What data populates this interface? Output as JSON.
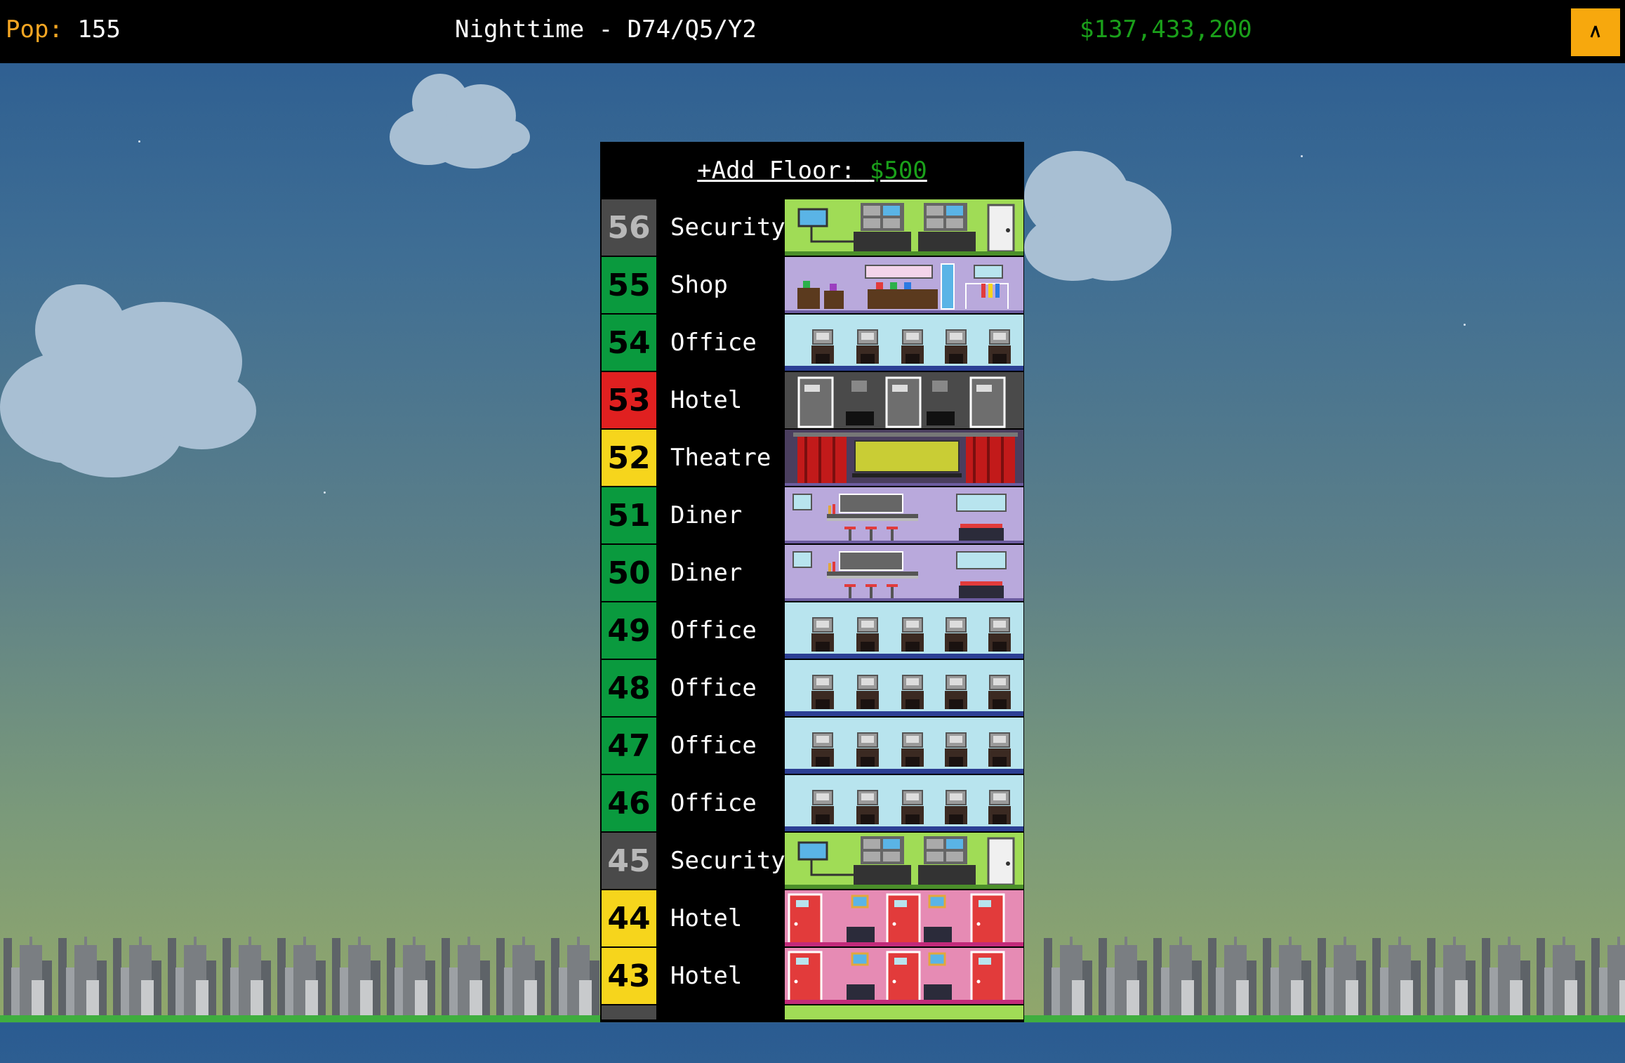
{
  "header": {
    "pop_label": "Pop:",
    "pop_value": "155",
    "time_text": "Nighttime - D74/Q5/Y2",
    "money": "$137,433,200",
    "menu_icon": "cursor-icon"
  },
  "tower": {
    "add_floor_label": "+Add Floor:",
    "add_floor_cost": "$500"
  },
  "colors": {
    "status_green": "#0a9a3e",
    "status_red": "#e02020",
    "status_yellow": "#f6d51c",
    "status_gray": "#4a4a4a"
  },
  "floors": [
    {
      "num": "56",
      "name": "Security",
      "type": "security",
      "status": "gray"
    },
    {
      "num": "55",
      "name": "Shop",
      "type": "shop",
      "status": "green"
    },
    {
      "num": "54",
      "name": "Office",
      "type": "office",
      "status": "green"
    },
    {
      "num": "53",
      "name": "Hotel",
      "type": "hotel-dark",
      "status": "red"
    },
    {
      "num": "52",
      "name": "Theatre",
      "type": "theatre",
      "status": "yellow"
    },
    {
      "num": "51",
      "name": "Diner",
      "type": "diner",
      "status": "green"
    },
    {
      "num": "50",
      "name": "Diner",
      "type": "diner",
      "status": "green"
    },
    {
      "num": "49",
      "name": "Office",
      "type": "office",
      "status": "green"
    },
    {
      "num": "48",
      "name": "Office",
      "type": "office",
      "status": "green"
    },
    {
      "num": "47",
      "name": "Office",
      "type": "office",
      "status": "green"
    },
    {
      "num": "46",
      "name": "Office",
      "type": "office",
      "status": "green"
    },
    {
      "num": "45",
      "name": "Security",
      "type": "security",
      "status": "gray"
    },
    {
      "num": "44",
      "name": "Hotel",
      "type": "hotel-pink",
      "status": "yellow"
    },
    {
      "num": "43",
      "name": "Hotel",
      "type": "hotel-pink",
      "status": "yellow"
    }
  ]
}
